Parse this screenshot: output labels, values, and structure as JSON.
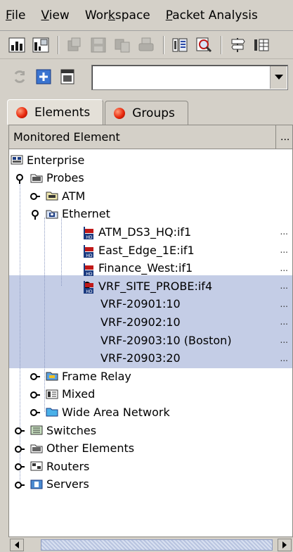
{
  "menu": [
    {
      "mnemonic": "F",
      "rest": "ile"
    },
    {
      "mnemonic": "V",
      "rest": "iew"
    },
    {
      "mnemonic": "",
      "pre": "Wor",
      "mid": "k",
      "rest": "space"
    },
    {
      "mnemonic": "P",
      "rest": "acket Analysis"
    }
  ],
  "toolbar": {
    "icons": [
      "chart-icon",
      "chart-split-icon",
      "copy-icon",
      "save-icon",
      "duplicate-icon",
      "print-icon",
      "filter-icon",
      "zoom-report-icon",
      "signpost-icon",
      "grid-icon"
    ]
  },
  "toolbar2": {
    "icons": [
      "refresh-icon",
      "add-icon",
      "calendar-icon"
    ],
    "combo_value": ""
  },
  "tabs": [
    {
      "label": "Elements",
      "active": true
    },
    {
      "label": "Groups",
      "active": false
    }
  ],
  "columns": {
    "monitored": "Monitored Element",
    "more": "..."
  },
  "tree": [
    {
      "label": "Enterprise",
      "icon": "enterprise-icon",
      "toggle": "none",
      "level": 0,
      "ell": ""
    },
    {
      "label": "Probes",
      "icon": "folder-icon",
      "toggle": "expanded",
      "level": 1,
      "ell": ""
    },
    {
      "label": "ATM",
      "icon": "atm-icon",
      "toggle": "collapsed",
      "level": 2,
      "ell": ""
    },
    {
      "label": "Ethernet",
      "icon": "ethernet-icon",
      "toggle": "expanded",
      "level": 2,
      "ell": ""
    },
    {
      "label": "ATM_DS3_HQ:if1",
      "icon": "probe-icon",
      "toggle": "none",
      "level": 4,
      "ell": "..."
    },
    {
      "label": "East_Edge_1E:if1",
      "icon": "probe-icon",
      "toggle": "none",
      "level": 4,
      "ell": "..."
    },
    {
      "label": "Finance_West:if1",
      "icon": "probe-icon",
      "toggle": "none",
      "level": 4,
      "ell": "..."
    },
    {
      "label": "VRF_SITE_PROBE:if4",
      "icon": "probe-icon",
      "toggle": "expanded",
      "level": 4,
      "ell": "..."
    },
    {
      "label": "VRF-20901:10",
      "icon": "",
      "toggle": "none",
      "level": 5,
      "ell": "..."
    },
    {
      "label": "VRF-20902:10",
      "icon": "",
      "toggle": "none",
      "level": 5,
      "ell": "..."
    },
    {
      "label": "VRF-20903:10 (Boston)",
      "icon": "",
      "toggle": "none",
      "level": 5,
      "ell": "..."
    },
    {
      "label": "VRF-20903:20",
      "icon": "",
      "toggle": "none",
      "level": 5,
      "ell": "..."
    },
    {
      "label": "Frame Relay",
      "icon": "frame-relay-icon",
      "toggle": "collapsed",
      "level": 2,
      "ell": ""
    },
    {
      "label": "Mixed",
      "icon": "mixed-icon",
      "toggle": "collapsed",
      "level": 2,
      "ell": ""
    },
    {
      "label": "Wide Area Network",
      "icon": "wan-icon",
      "toggle": "collapsed",
      "level": 2,
      "ell": ""
    },
    {
      "label": "Switches",
      "icon": "switch-icon",
      "toggle": "collapsed",
      "level": 1,
      "ell": ""
    },
    {
      "label": "Other Elements",
      "icon": "other-elements-icon",
      "toggle": "collapsed",
      "level": 1,
      "ell": ""
    },
    {
      "label": "Routers",
      "icon": "router-icon",
      "toggle": "collapsed",
      "level": 1,
      "ell": ""
    },
    {
      "label": "Servers",
      "icon": "server-icon",
      "toggle": "collapsed",
      "level": 1,
      "ell": ""
    }
  ],
  "selected_rows": [
    "VRF_SITE_PROBE:if4",
    "VRF-20901:10",
    "VRF-20902:10",
    "VRF-20903:10 (Boston)",
    "VRF-20903:20"
  ]
}
